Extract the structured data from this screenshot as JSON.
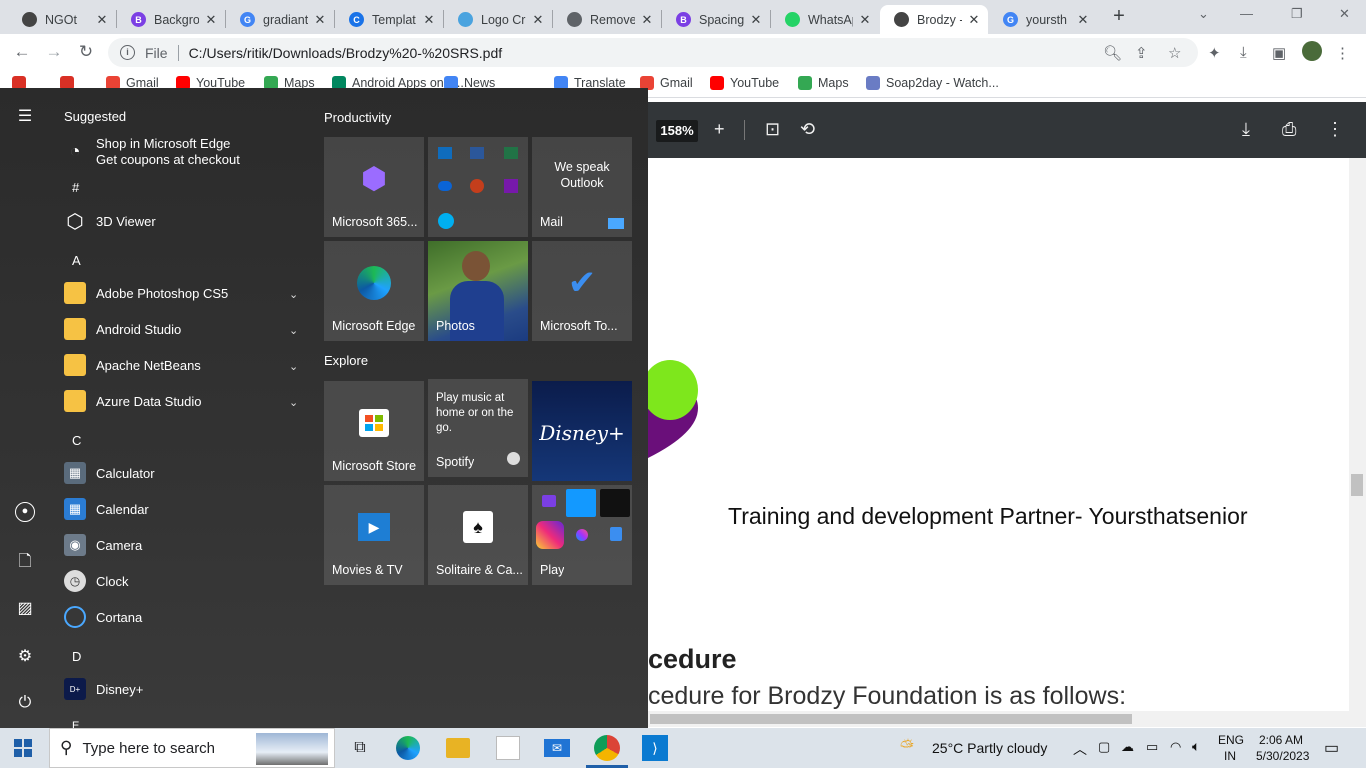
{
  "browser": {
    "tabs": [
      {
        "title": "NGOt",
        "fav_color": "#444",
        "fav_text": ""
      },
      {
        "title": "Backgro",
        "fav_color": "#7b3fe4",
        "fav_text": "B"
      },
      {
        "title": "gradiant",
        "fav_color": "#4285f4",
        "fav_text": "G"
      },
      {
        "title": "Templat",
        "fav_color": "#1a73e8",
        "fav_text": "C"
      },
      {
        "title": "Logo Cr",
        "fav_color": "#4aa3df",
        "fav_text": ""
      },
      {
        "title": "Remove",
        "fav_color": "#5f6368",
        "fav_text": ""
      },
      {
        "title": "Spacing",
        "fav_color": "#7b3fe4",
        "fav_text": "B"
      },
      {
        "title": "WhatsAp",
        "fav_color": "#25d366",
        "fav_text": ""
      },
      {
        "title": "Brodzy -",
        "fav_color": "#444",
        "fav_text": ""
      },
      {
        "title": "yoursth",
        "fav_color": "#4285f4",
        "fav_text": "G"
      }
    ],
    "new_tab_label": "+",
    "omnibox": {
      "scheme_label": "File",
      "url": "C:/Users/ritik/Downloads/Brodzy%20-%20SRS.pdf"
    },
    "bookmarks": [
      {
        "label": "",
        "color": "#d93025"
      },
      {
        "label": "",
        "color": "#d93025"
      },
      {
        "label": "Gmail",
        "color": "#ea4335"
      },
      {
        "label": "YouTube",
        "color": "#ff0000"
      },
      {
        "label": "Maps",
        "color": "#34a853"
      },
      {
        "label": "Android Apps on G...",
        "color": "#01875f"
      },
      {
        "label": "News",
        "color": "#4285f4"
      },
      {
        "label": "Translate",
        "color": "#4285f4"
      },
      {
        "label": "Gmail",
        "color": "#ea4335"
      },
      {
        "label": "YouTube",
        "color": "#ff0000"
      },
      {
        "label": "Maps",
        "color": "#34a853"
      },
      {
        "label": "Soap2day - Watch...",
        "color": "#6a7cc4"
      }
    ]
  },
  "pdf": {
    "zoom": "158%",
    "partner_text": "Training and development Partner- Yoursthatsenior",
    "heading_fragment": "cedure",
    "sub_fragment": "cedure for Brodzy Foundation is as follows:"
  },
  "start_menu": {
    "suggested_label": "Suggested",
    "suggested_app": {
      "line1": "Shop in Microsoft Edge",
      "line2": "Get coupons at checkout"
    },
    "letters": [
      "#",
      "A",
      "C",
      "D",
      "E"
    ],
    "apps": [
      {
        "name": "3D Viewer"
      },
      {
        "name": "Adobe Photoshop CS5"
      },
      {
        "name": "Android Studio"
      },
      {
        "name": "Apache NetBeans"
      },
      {
        "name": "Azure Data Studio"
      },
      {
        "name": "Calculator"
      },
      {
        "name": "Calendar"
      },
      {
        "name": "Camera"
      },
      {
        "name": "Clock"
      },
      {
        "name": "Cortana"
      },
      {
        "name": "Disney+"
      }
    ],
    "groups": {
      "productivity": "Productivity",
      "explore": "Explore"
    },
    "tiles": {
      "m365": "Microsoft 365...",
      "mail_label": "Mail",
      "mail_promo": "We speak Outlook",
      "edge": "Microsoft Edge",
      "photos": "Photos",
      "todo": "Microsoft To...",
      "store": "Microsoft Store",
      "spotify": "Spotify",
      "spotify_promo": "Play music at home or on the go.",
      "disney_logo": "Disney+",
      "movies": "Movies & TV",
      "solitaire": "Solitaire & Ca...",
      "play": "Play"
    }
  },
  "taskbar": {
    "search_placeholder": "Type here to search",
    "weather": "25°C  Partly cloudy",
    "lang_1": "ENG",
    "lang_2": "IN",
    "time": "2:06 AM",
    "date": "5/30/2023"
  }
}
